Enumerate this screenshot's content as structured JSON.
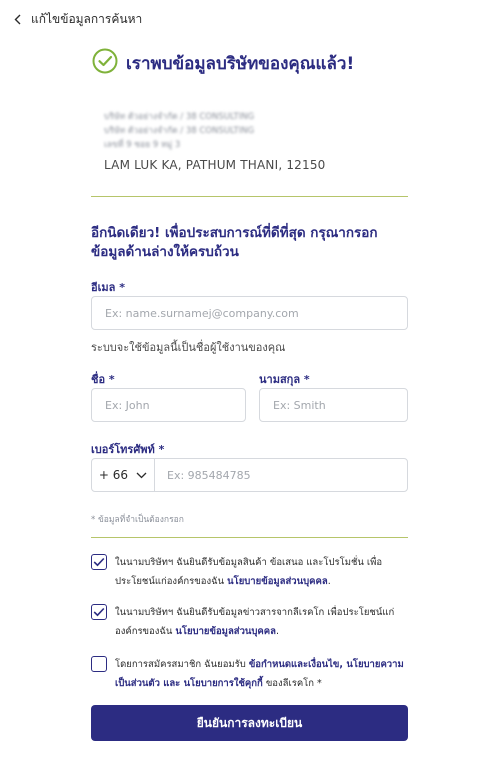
{
  "header": {
    "back_label": "แก้ไขข้อมูลการค้นหา"
  },
  "success": {
    "title": "เราพบข้อมูลบริษัทของคุณแล้ว!"
  },
  "company": {
    "line1": "บริษัท ตัวอย่างจำกัด / 38 CONSULTING",
    "line2": "บริษัท ตัวอย่างจำกัด / 38 CONSULTING",
    "line3": "เลขที่ 9 ซอย 9 หมู่ 3",
    "address": "LAM LUK KA, PATHUM THANI, 12150"
  },
  "form": {
    "subtitle": "อีกนิดเดียว! เพื่อประสบการณ์ที่ดีที่สุด กรุณากรอกข้อมูลด้านล่างให้ครบถ้วน",
    "email_label": "อีเมล *",
    "email_placeholder": "Ex: name.surnamej@company.com",
    "email_hint": "ระบบจะใช้ข้อมูลนี้เป็นชื่อผู้ใช้งานของคุณ",
    "firstname_label": "ชื่อ *",
    "firstname_placeholder": "Ex: John",
    "lastname_label": "นามสกุล *",
    "lastname_placeholder": "Ex: Smith",
    "phone_label": "เบอร์โทรศัพท์ *",
    "phone_code": "+ 66",
    "phone_placeholder": "Ex: 985484785",
    "required_note": "* ข้อมูลที่จำเป็นต้องกรอก"
  },
  "consents": [
    {
      "checked": true,
      "text": "ในนามบริษัทฯ ฉันยินดีรับข้อมูลสินค้า ข้อเสนอ และโปรโมชั่น เพื่อประโยชน์แก่องค์กรของฉัน ",
      "link": "นโยบายข้อมูลส่วนบุคคล",
      "suffix": "."
    },
    {
      "checked": true,
      "text": "ในนามบริษัทฯ ฉันยินดีรับข้อมูลข่าวสารจากลีเรคโก เพื่อประโยชน์แก่องค์กรของฉัน ",
      "link": "นโยบายข้อมูลส่วนบุคคล",
      "suffix": "."
    },
    {
      "checked": false,
      "text": "โดยการสมัครสมาชิก ฉันยอมรับ ",
      "link": "ข้อกำหนดและเงื่อนไข, นโยบายความเป็นส่วนตัว และ นโยบายการใช้คุกกี้",
      "suffix": " ของลีเรคโก *"
    }
  ],
  "submit_label": "ยืนยันการลงทะเบียน",
  "colors": {
    "primary": "#2c2c82",
    "accent": "#7fb23a",
    "divider": "#b6c56a"
  }
}
